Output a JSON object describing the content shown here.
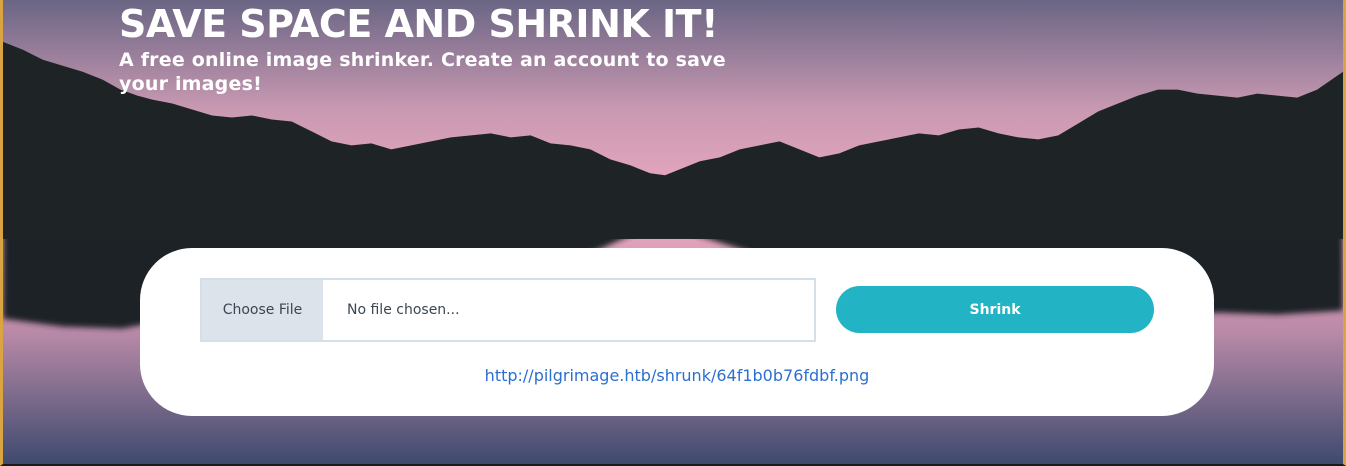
{
  "hero": {
    "title": "SAVE SPACE AND SHRINK IT!",
    "subtitle": "A free online image shrinker. Create an account to save your images!"
  },
  "upload": {
    "choose_file_label": "Choose File",
    "file_status": "No file chosen...",
    "shrink_label": "Shrink"
  },
  "result": {
    "link_text": "http://pilgrimage.htb/shrunk/64f1b0b76fdbf.png"
  },
  "colors": {
    "sky_top": "#6a6584",
    "sky_horizon": "#e4a9bf",
    "mountain": "#1e2426",
    "accent": "#22b4c4",
    "link": "#2a6fd1",
    "frame_border": "#d9a441"
  },
  "icons": {
    "background": "mountain-lake-scene"
  }
}
